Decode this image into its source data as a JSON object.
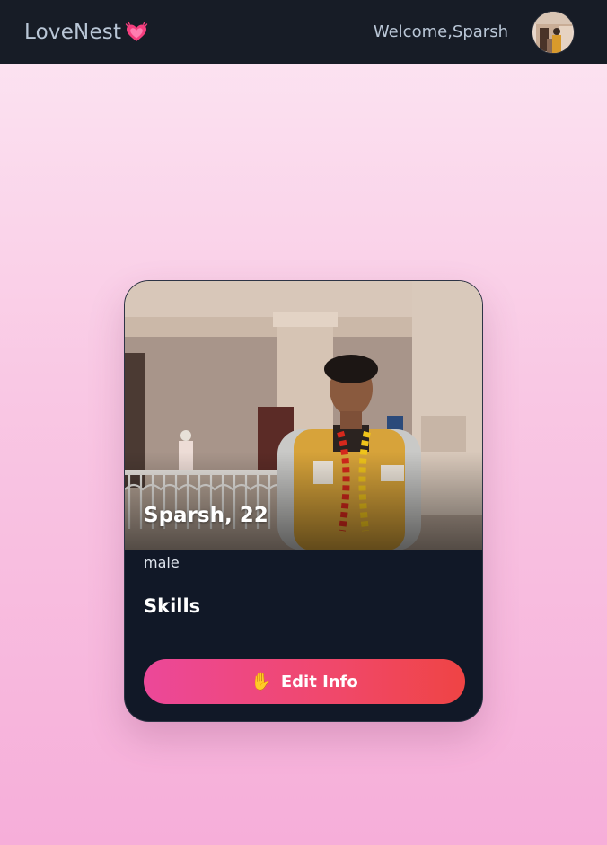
{
  "navbar": {
    "brand": "LoveNest",
    "brand_icon": "sparkling-heart-icon",
    "welcome_text": "Welcome,Sparsh",
    "avatar_icon": "user-avatar"
  },
  "profile_card": {
    "name_age": "Sparsh, 22",
    "gender": "male",
    "skills_heading": "Skills",
    "skills": [],
    "photo_icon": "profile-photo",
    "edit_button": {
      "icon": "raised-hand-icon",
      "icon_glyph": "✋",
      "label": "Edit Info"
    }
  },
  "colors": {
    "navbar_bg": "#171c26",
    "card_bg": "#111827",
    "button_start": "#ec4899",
    "button_end": "#ef4444",
    "page_bg_top": "#fce7f3",
    "page_bg_bottom": "#f6aed9"
  }
}
